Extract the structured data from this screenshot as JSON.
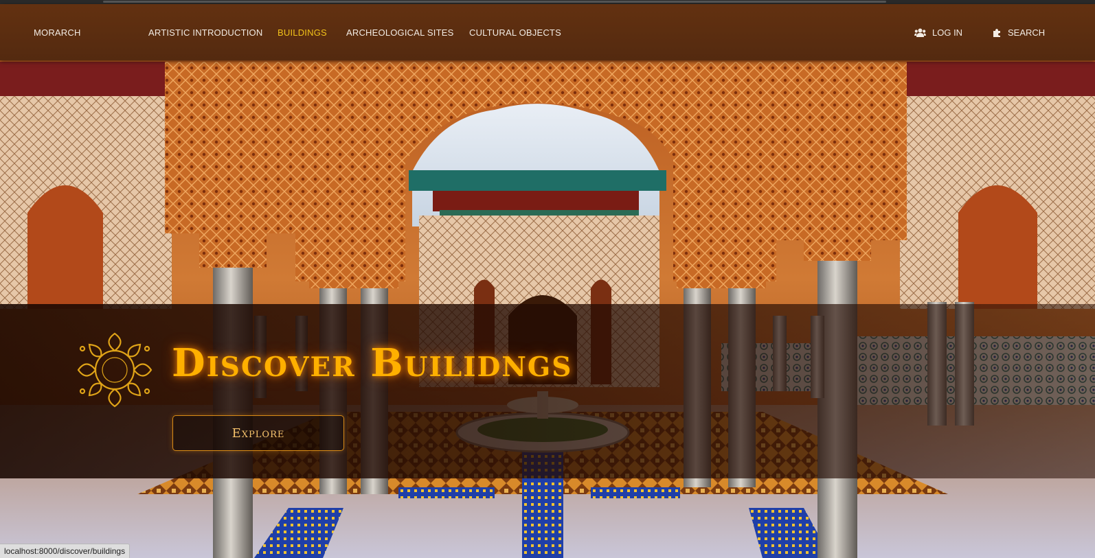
{
  "nav": {
    "brand": "MORARCH",
    "items": [
      {
        "label": "ARTISTIC INTRODUCTION",
        "active": false
      },
      {
        "label": "BUILDINGS",
        "active": true
      },
      {
        "label": "ARCHEOLOGICAL SITES",
        "active": false
      },
      {
        "label": "CULTURAL OBJECTS",
        "active": false
      }
    ],
    "login": {
      "label": "LOG IN",
      "icon": "users-icon"
    },
    "search": {
      "label": "SEARCH",
      "icon": "puzzle-icon"
    }
  },
  "hero": {
    "title": "Discover Builidngs",
    "button_label": "Explore",
    "emblem_icon": "ornament-icon",
    "background": "moorish-courtyard-photo"
  },
  "status_bar": {
    "url": "localhost:8000/discover/buildings"
  },
  "colors": {
    "nav_background": "#5a2c10",
    "active_nav": "#f2c21a",
    "title": "#ffb000",
    "button_border": "#d98b16"
  }
}
